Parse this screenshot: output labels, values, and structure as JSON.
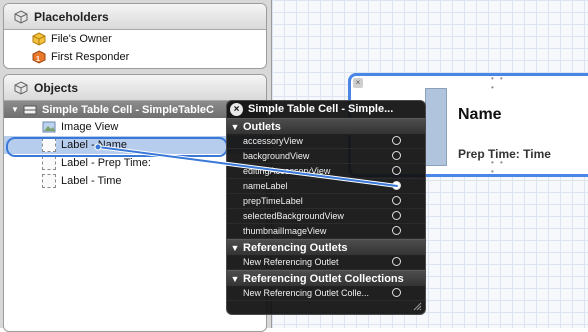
{
  "outline": {
    "placeholders_header": "Placeholders",
    "placeholders": [
      {
        "label": "File's Owner",
        "icon": "files-owner-icon"
      },
      {
        "label": "First Responder",
        "icon": "first-responder-icon"
      }
    ],
    "objects_header": "Objects",
    "tree": {
      "root": "Simple Table Cell - SimpleTableC",
      "items": [
        {
          "label": "Image View",
          "icon": "image-view-icon"
        },
        {
          "label": "Label - Name",
          "icon": "label-icon"
        },
        {
          "label": "Label - Prep Time:",
          "icon": "label-icon"
        },
        {
          "label": "Label - Time",
          "icon": "label-icon"
        }
      ]
    }
  },
  "canvas": {
    "cell_name": "Name",
    "cell_prep": "Prep Time: Time",
    "dots": "• • •"
  },
  "hud": {
    "close": "×",
    "title": "Simple Table Cell - Simple...",
    "sections": [
      {
        "label": "Outlets",
        "tri": "▼"
      },
      {
        "label": "Referencing Outlets",
        "tri": "▼"
      },
      {
        "label": "Referencing Outlet Collections",
        "tri": "▼"
      }
    ],
    "outlets": [
      {
        "label": "accessoryView",
        "connected": false
      },
      {
        "label": "backgroundView",
        "connected": false
      },
      {
        "label": "editingAccessoryView",
        "connected": false
      },
      {
        "label": "nameLabel",
        "connected": true
      },
      {
        "label": "prepTimeLabel",
        "connected": false
      },
      {
        "label": "selectedBackgroundView",
        "connected": false
      },
      {
        "label": "thumbnailImageView",
        "connected": false
      }
    ],
    "referencing_outlet": "New Referencing Outlet",
    "referencing_collection": "New Referencing Outlet Colle..."
  },
  "colors": {
    "selection_blue": "#3a78d8",
    "hud_bg": "#121212"
  }
}
